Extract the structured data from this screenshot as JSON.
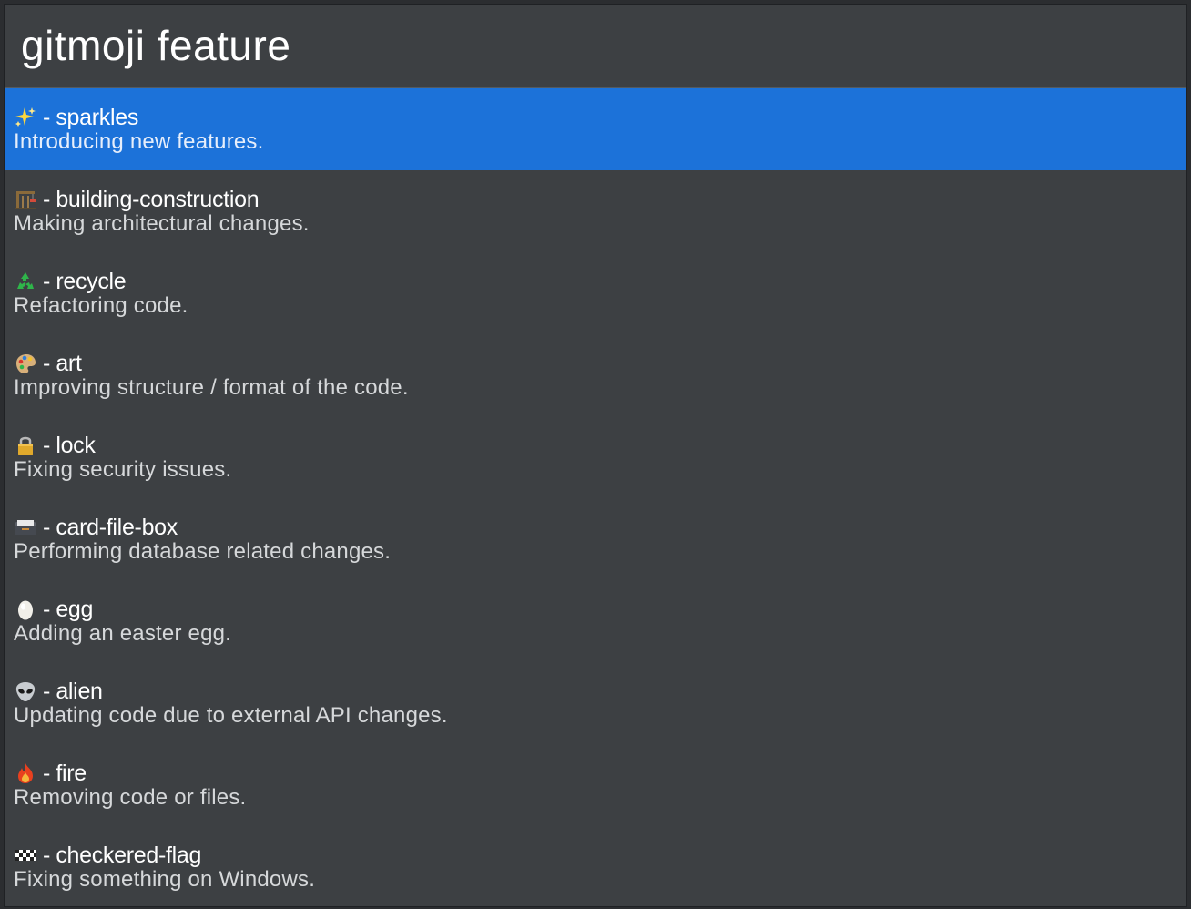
{
  "search": {
    "query": "gitmoji feature"
  },
  "results": [
    {
      "icon": "sparkles-icon",
      "name": "sparkles",
      "description": "Introducing new features.",
      "selected": true
    },
    {
      "icon": "building-construction-icon",
      "name": "building-construction",
      "description": "Making architectural changes.",
      "selected": false
    },
    {
      "icon": "recycle-icon",
      "name": "recycle",
      "description": "Refactoring code.",
      "selected": false
    },
    {
      "icon": "art-icon",
      "name": "art",
      "description": "Improving structure / format of the code.",
      "selected": false
    },
    {
      "icon": "lock-icon",
      "name": "lock",
      "description": "Fixing security issues.",
      "selected": false
    },
    {
      "icon": "card-file-box-icon",
      "name": "card-file-box",
      "description": "Performing database related changes.",
      "selected": false
    },
    {
      "icon": "egg-icon",
      "name": "egg",
      "description": "Adding an easter egg.",
      "selected": false
    },
    {
      "icon": "alien-icon",
      "name": "alien",
      "description": "Updating code due to external API changes.",
      "selected": false
    },
    {
      "icon": "fire-icon",
      "name": "fire",
      "description": "Removing code or files.",
      "selected": false
    },
    {
      "icon": "checkered-flag-icon",
      "name": "checkered-flag",
      "description": "Fixing something on Windows.",
      "selected": false
    }
  ],
  "separator": "-",
  "colors": {
    "selected_row": "#1c72d9",
    "panel_background": "#3d4043",
    "text_primary": "#ffffff",
    "text_secondary": "#d6d8da"
  }
}
